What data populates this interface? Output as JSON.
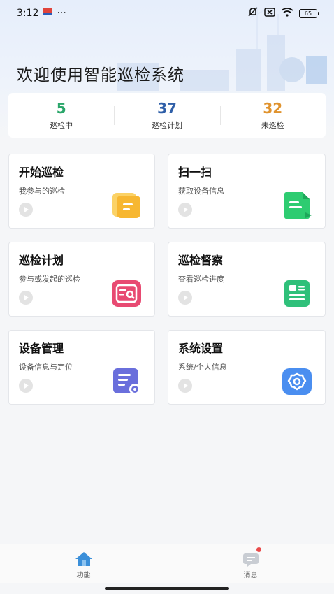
{
  "status_bar": {
    "time": "3:12",
    "more": "···",
    "battery": "65"
  },
  "header": {
    "welcome": "欢迎使用智能巡检系统"
  },
  "stats": [
    {
      "value": "5",
      "label": "巡检中",
      "color": "#2aa66a"
    },
    {
      "value": "37",
      "label": "巡检计划",
      "color": "#2f5fa8"
    },
    {
      "value": "32",
      "label": "未巡检",
      "color": "#e0932e"
    }
  ],
  "cards": [
    {
      "title": "开始巡检",
      "subtitle": "我参与的巡检",
      "icon": "folder-icon",
      "color": "#f7b731"
    },
    {
      "title": "扫一扫",
      "subtitle": "获取设备信息",
      "icon": "document-icon",
      "color": "#2ecc71"
    },
    {
      "title": "巡检计划",
      "subtitle": "参与或发起的巡检",
      "icon": "search-doc-icon",
      "color": "#e84a72"
    },
    {
      "title": "巡检督察",
      "subtitle": "查看巡检进度",
      "icon": "list-doc-icon",
      "color": "#2fc07a"
    },
    {
      "title": "设备管理",
      "subtitle": "设备信息与定位",
      "icon": "device-list-icon",
      "color": "#6a6fdc"
    },
    {
      "title": "系统设置",
      "subtitle": "系统/个人信息",
      "icon": "gear-icon",
      "color": "#4a8ef0"
    }
  ],
  "tabbar": [
    {
      "label": "功能",
      "icon": "home-icon",
      "active": true
    },
    {
      "label": "消息",
      "icon": "message-icon",
      "active": false
    }
  ]
}
